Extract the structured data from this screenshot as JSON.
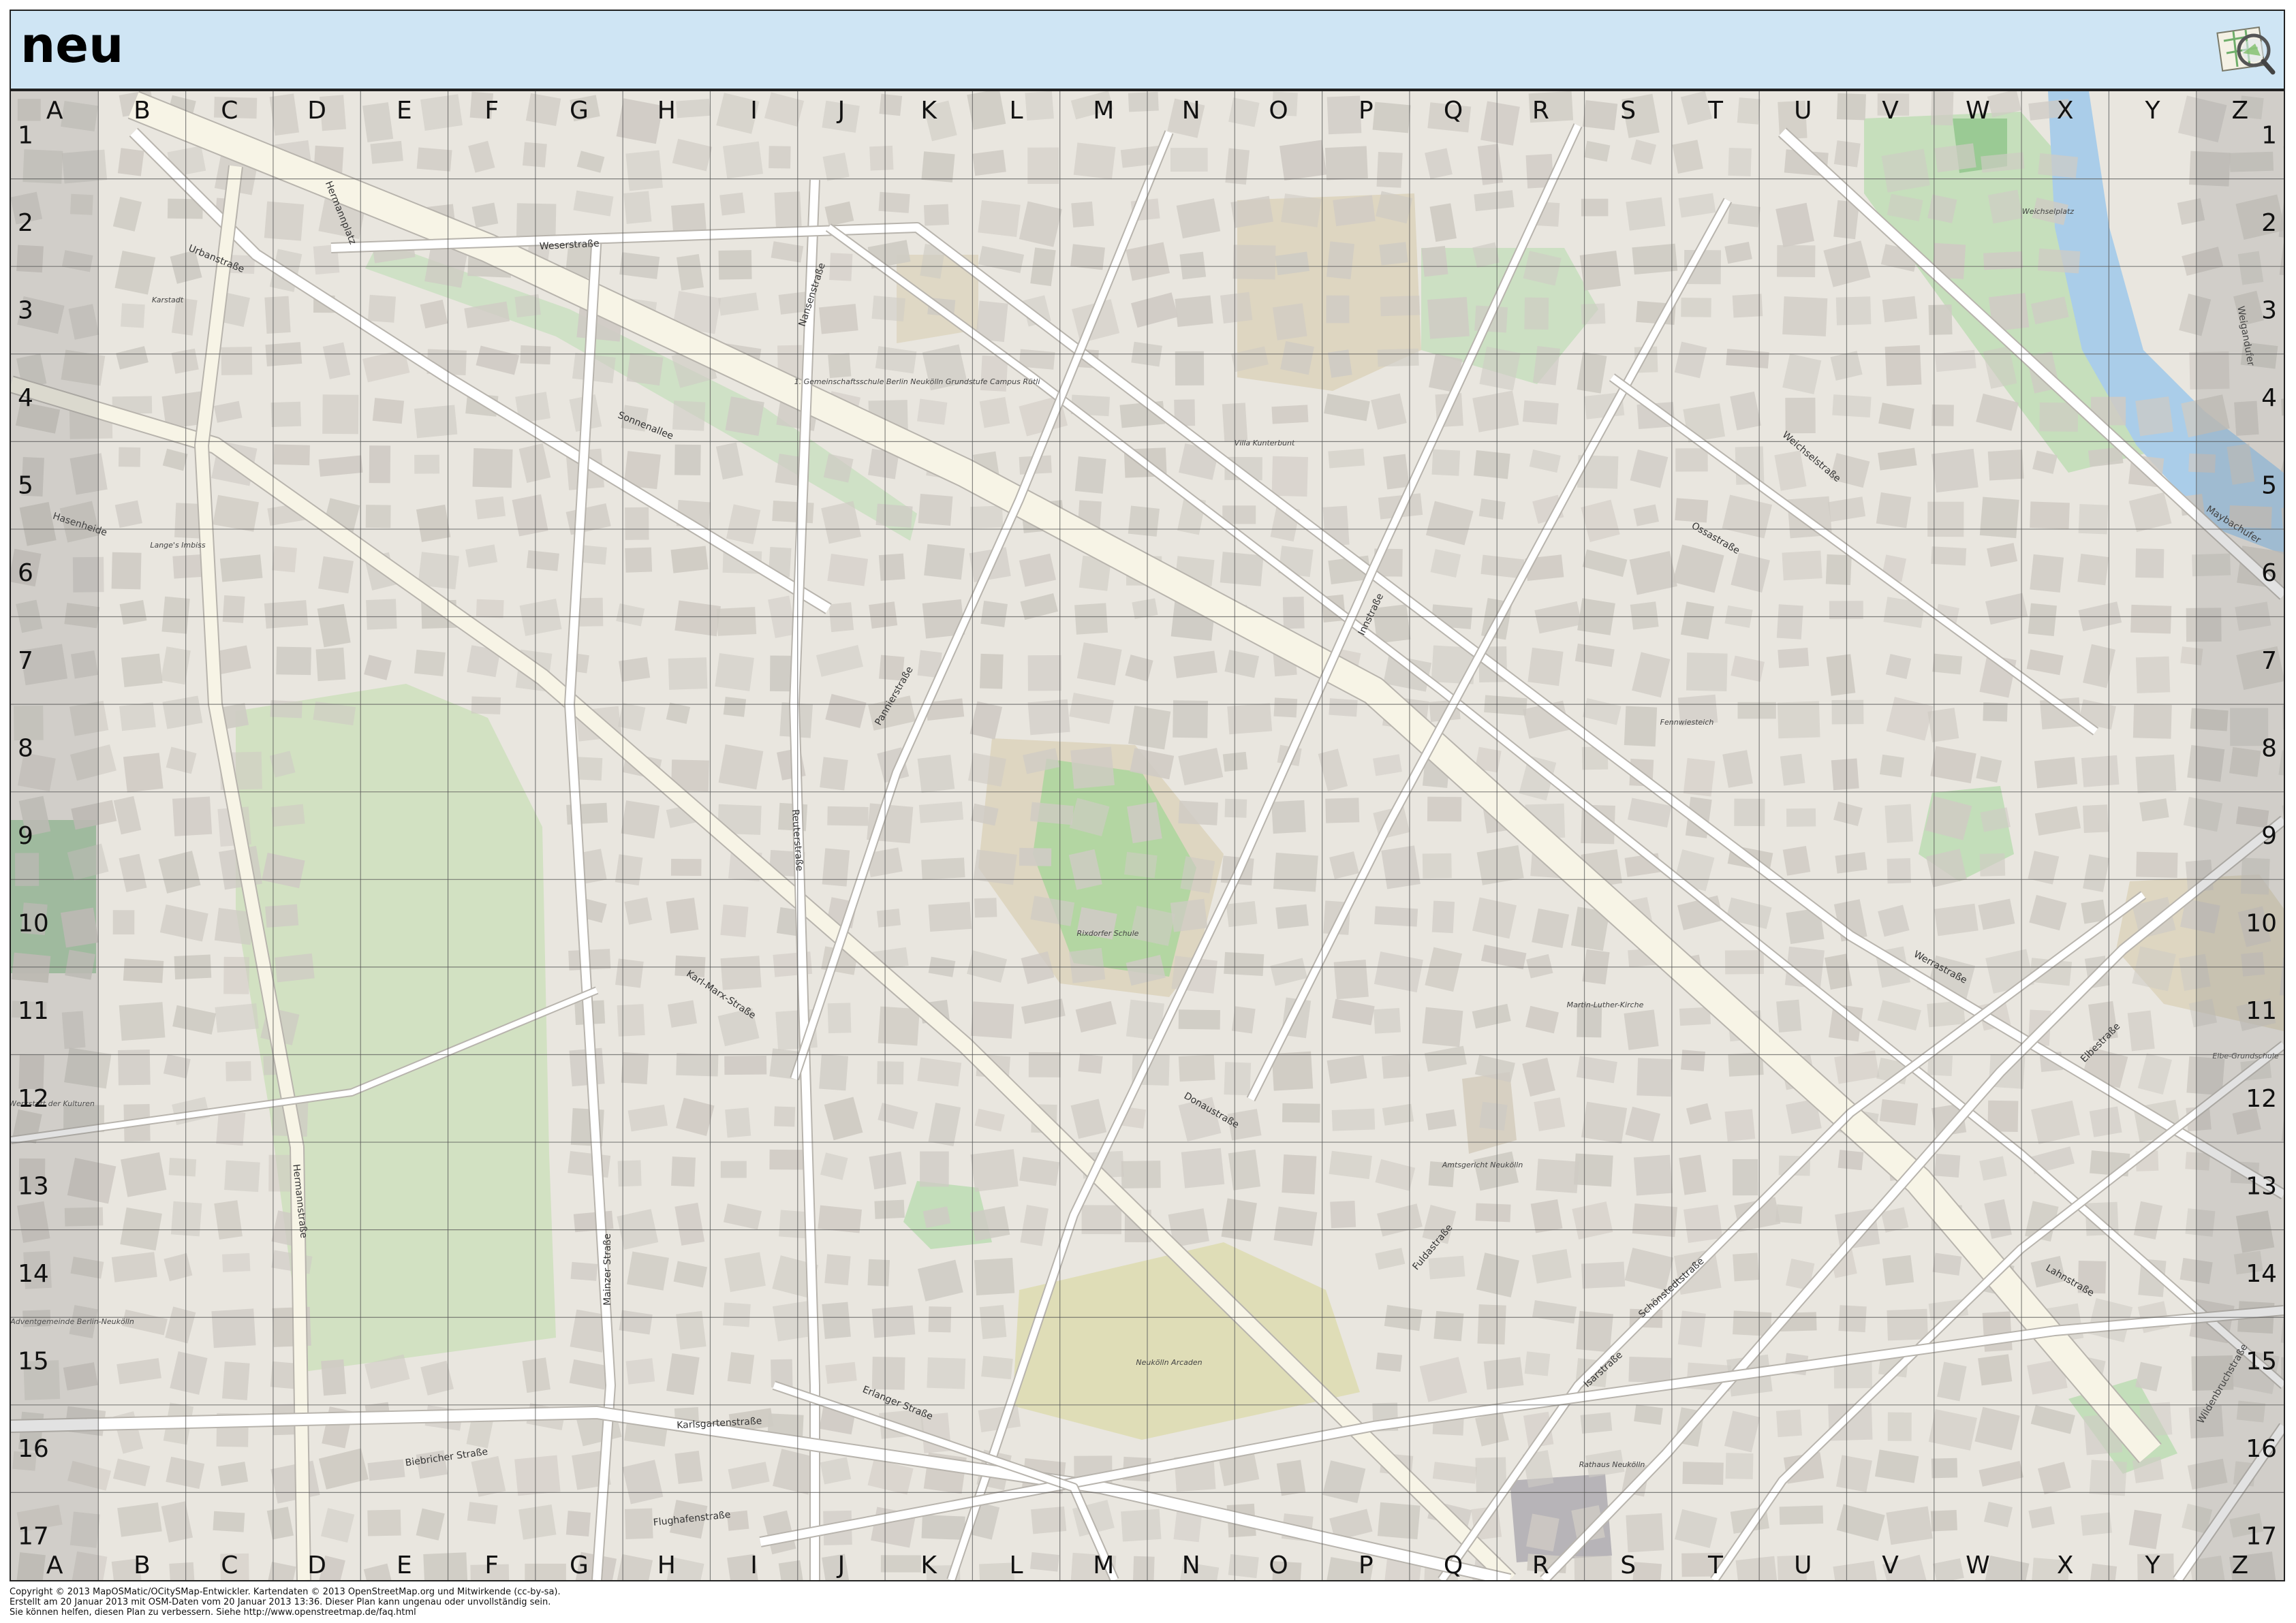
{
  "header": {
    "title": "neu",
    "logo_icon": "maposmatic-logo-icon"
  },
  "grid": {
    "columns": [
      "A",
      "B",
      "C",
      "D",
      "E",
      "F",
      "G",
      "H",
      "I",
      "J",
      "K",
      "L",
      "M",
      "N",
      "O",
      "P",
      "Q",
      "R",
      "S",
      "T",
      "U",
      "V",
      "W",
      "X",
      "Y",
      "Z"
    ],
    "rows": [
      "1",
      "2",
      "3",
      "4",
      "5",
      "6",
      "7",
      "8",
      "9",
      "10",
      "11",
      "12",
      "13",
      "14",
      "15",
      "16",
      "17"
    ]
  },
  "map": {
    "colors": {
      "land": "#e9e6df",
      "building": "#cfcbc4",
      "road": "#ffffff",
      "major_road": "#f7f4e6",
      "park": "#c9dfb8",
      "grass": "#b9dcb0",
      "water": "#aacde9",
      "school": "#d8cfb4",
      "grid_line": "#555555",
      "edge_shade": "#7a7a7a"
    },
    "street_labels": [
      "Weserstraße",
      "Sonnenallee",
      "Hermannplatz",
      "Hasenheide",
      "Karl-Marx-Straße",
      "Hermannstraße",
      "Reuterstraße",
      "Pannierstraße",
      "Weichselstraße",
      "Donaustraße",
      "Innstraße",
      "Fuldastraße",
      "Ossastraße",
      "Wildenbruchstraße",
      "Flughafenstraße",
      "Erlanger Straße",
      "Elbestraße",
      "Lahnstraße",
      "Maybachufer",
      "Weigandufer",
      "Karlsgartenstraße",
      "Biebricher Straße",
      "Mainzer Straße",
      "Urbanstraße",
      "Isarstraße",
      "Schönstedtstraße",
      "Werrastraße",
      "Nansenstraße"
    ],
    "poi_labels": [
      "Karstadt",
      "Lange's Imbiss",
      "1. Gemeinschaftsschule Berlin Neukölln Grundstufe Campus Rütli",
      "Villa Kunterbunt",
      "Weichselplatz",
      "Rixdorfer Schule",
      "Martin-Luther-Kirche",
      "Elbe-Grundschule",
      "Neukölln Arcaden",
      "Amtsgericht Neukölln",
      "Rathaus Neukölln",
      "Werkstatt der Kulturen",
      "Adventgemeinde Berlin-Neukölln",
      "Fennwiesteich"
    ]
  },
  "footer": {
    "line1": "Copyright © 2013 MapOSMatic/OCitySMap-Entwickler. Kartendaten © 2013 OpenStreetMap.org und Mitwirkende (cc-by-sa).",
    "line2": "Erstellt am 20 Januar 2013 mit OSM-Daten vom 20 Januar 2013 13:36. Dieser Plan kann ungenau oder unvollständig sein.",
    "line3": "Sie können helfen, diesen Plan zu verbessern. Siehe http://www.openstreetmap.de/faq.html"
  }
}
